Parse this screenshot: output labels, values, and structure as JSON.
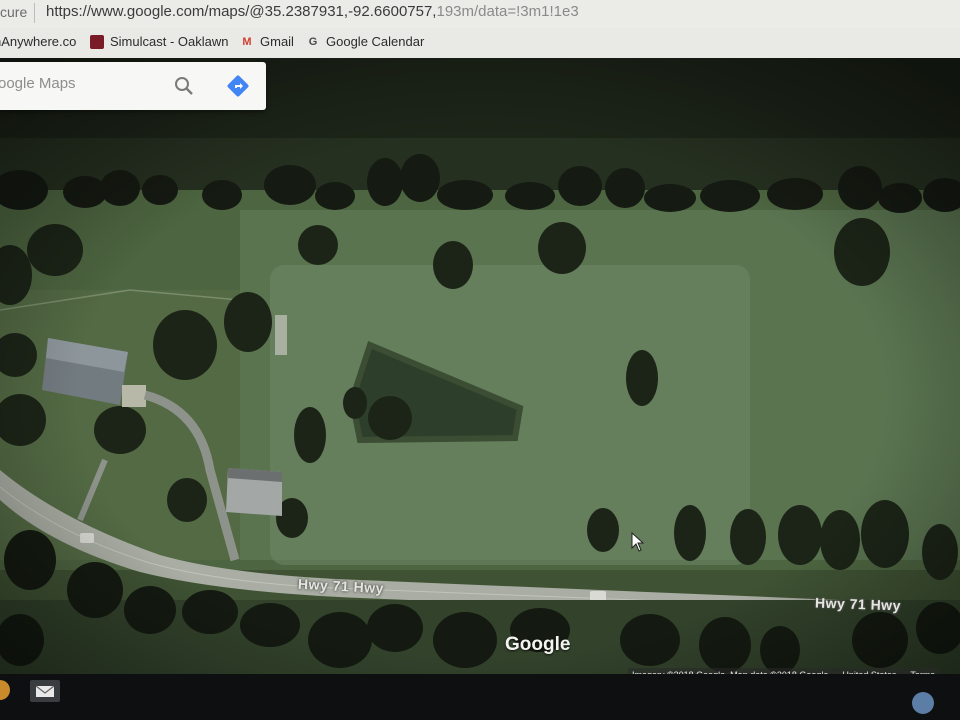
{
  "browser": {
    "secure_label": "cure",
    "url_prefix": "https://www.google.com/maps/@35.2387931,-92.6600757,",
    "url_suffix": "193m/data=!3m1!1e3"
  },
  "bookmarks": [
    {
      "label": "nAnywhere.co",
      "icon": "web-icon"
    },
    {
      "label": "Simulcast - Oaklawn",
      "icon": "simulcast-icon"
    },
    {
      "label": "Gmail",
      "icon": "gmail-icon"
    },
    {
      "label": "Google Calendar",
      "icon": "google-icon"
    }
  ],
  "search": {
    "placeholder": "oogle Maps"
  },
  "map": {
    "road_labels": [
      "Hwy 71 Hwy",
      "Hwy 71 Hwy"
    ],
    "brand": "Google",
    "attribution": {
      "imagery": "Imagery ©2018 Google, Map data ©2018 Google",
      "region": "United States",
      "terms": "Terms"
    }
  },
  "colors": {
    "map_accent": "#4285f4",
    "taskbar": "#0d0f10"
  }
}
